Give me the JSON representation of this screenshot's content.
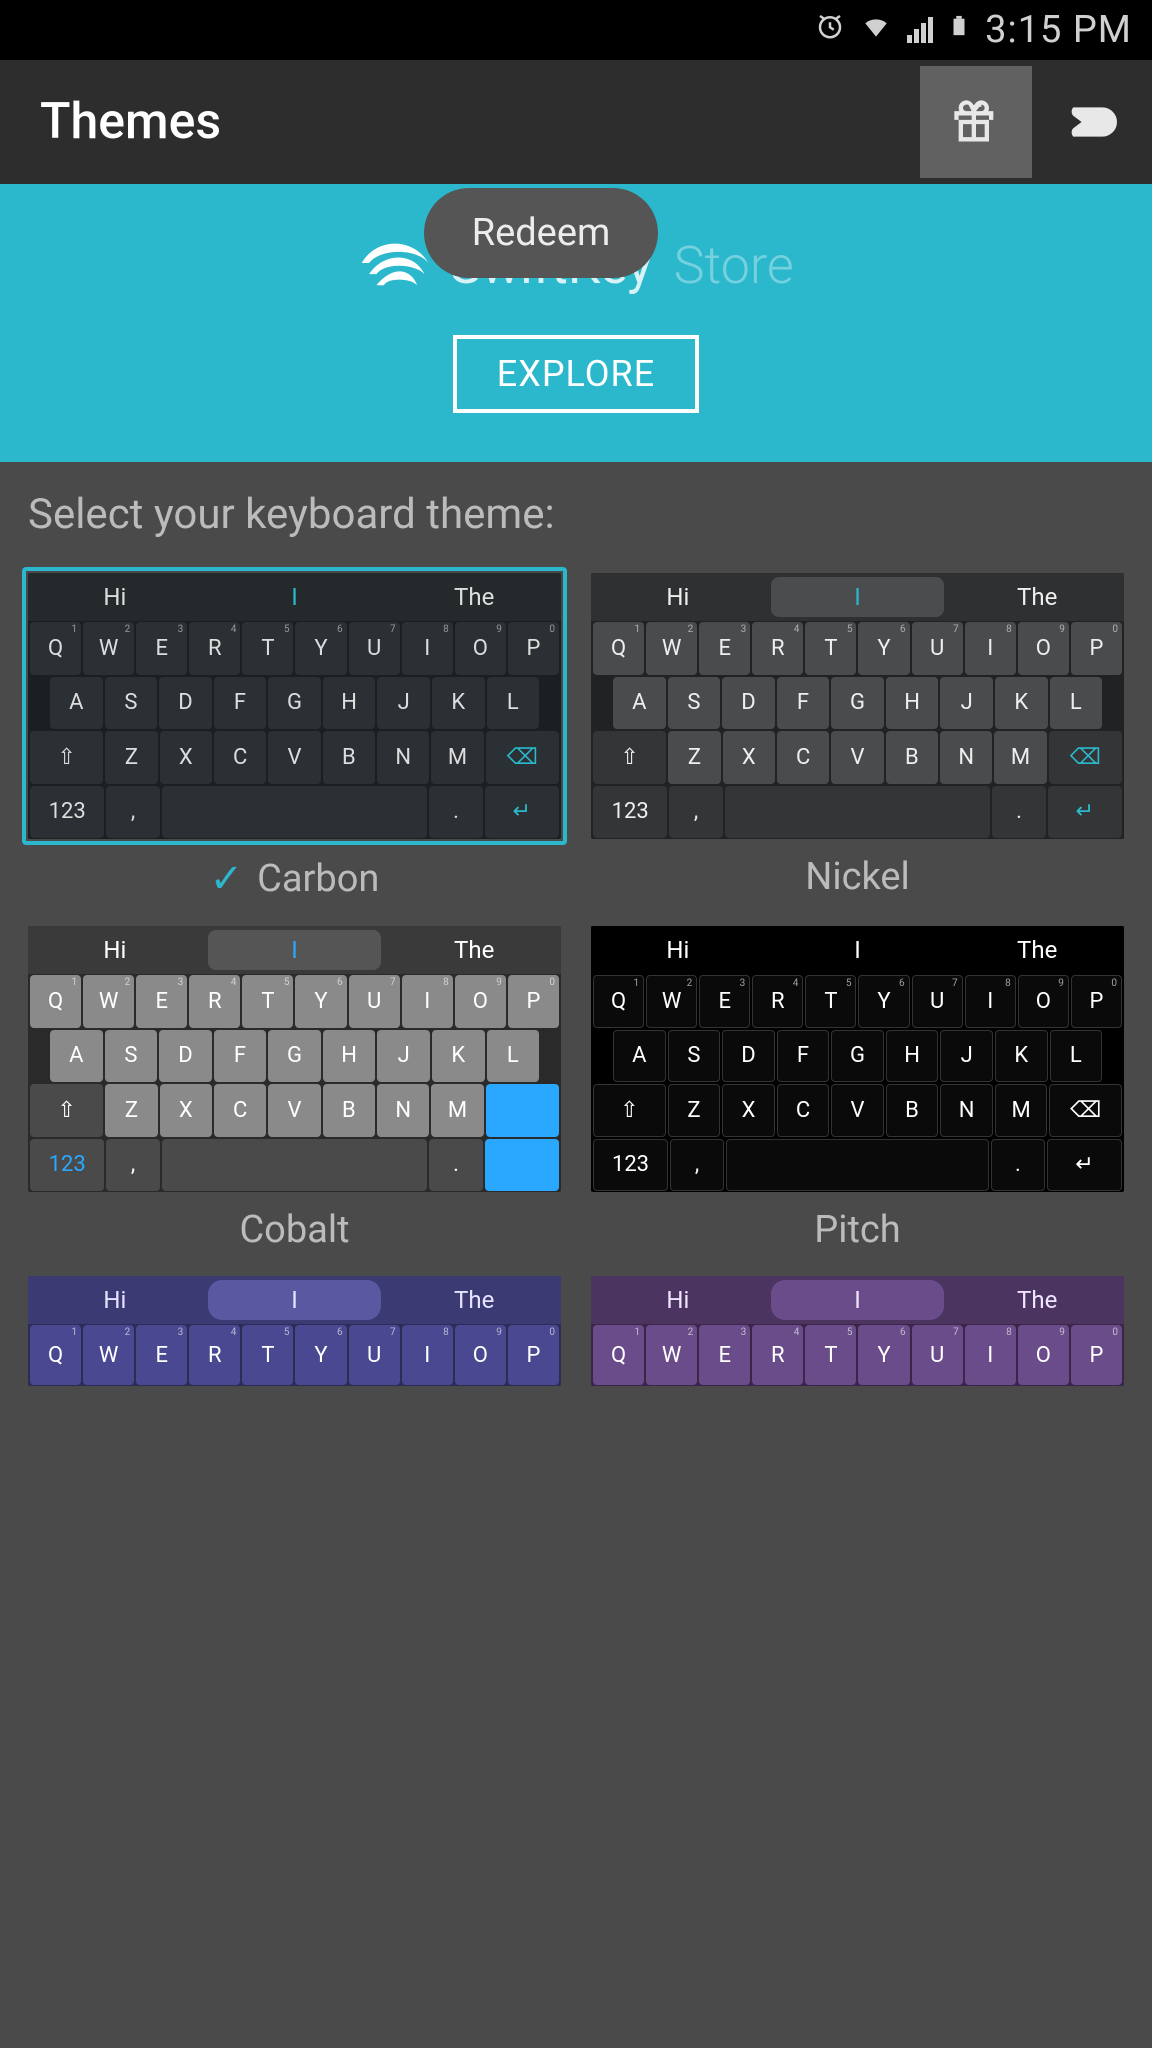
{
  "status": {
    "time": "3:15 PM"
  },
  "appbar": {
    "title": "Themes"
  },
  "tooltip": "Redeem",
  "banner": {
    "brand": "SwiftKey",
    "store": "Store",
    "explore": "EXPLORE"
  },
  "section": {
    "title": "Select your keyboard theme:"
  },
  "suggestions": [
    "Hi",
    "I",
    "The"
  ],
  "rows": {
    "r1": [
      "Q",
      "W",
      "E",
      "R",
      "T",
      "Y",
      "U",
      "I",
      "O",
      "P"
    ],
    "r2": [
      "A",
      "S",
      "D",
      "F",
      "G",
      "H",
      "J",
      "K",
      "L"
    ],
    "r3": [
      "Z",
      "X",
      "C",
      "V",
      "B",
      "N",
      "M"
    ],
    "nums": "123"
  },
  "themes": [
    {
      "name": "Carbon",
      "selected": true,
      "skin": "carbon"
    },
    {
      "name": "Nickel",
      "selected": false,
      "skin": "nickel"
    },
    {
      "name": "Cobalt",
      "selected": false,
      "skin": "cobalt"
    },
    {
      "name": "Pitch",
      "selected": false,
      "skin": "pitch"
    },
    {
      "name": "",
      "selected": false,
      "skin": "indigo",
      "partial": true
    },
    {
      "name": "",
      "selected": false,
      "skin": "violet",
      "partial": true
    }
  ]
}
